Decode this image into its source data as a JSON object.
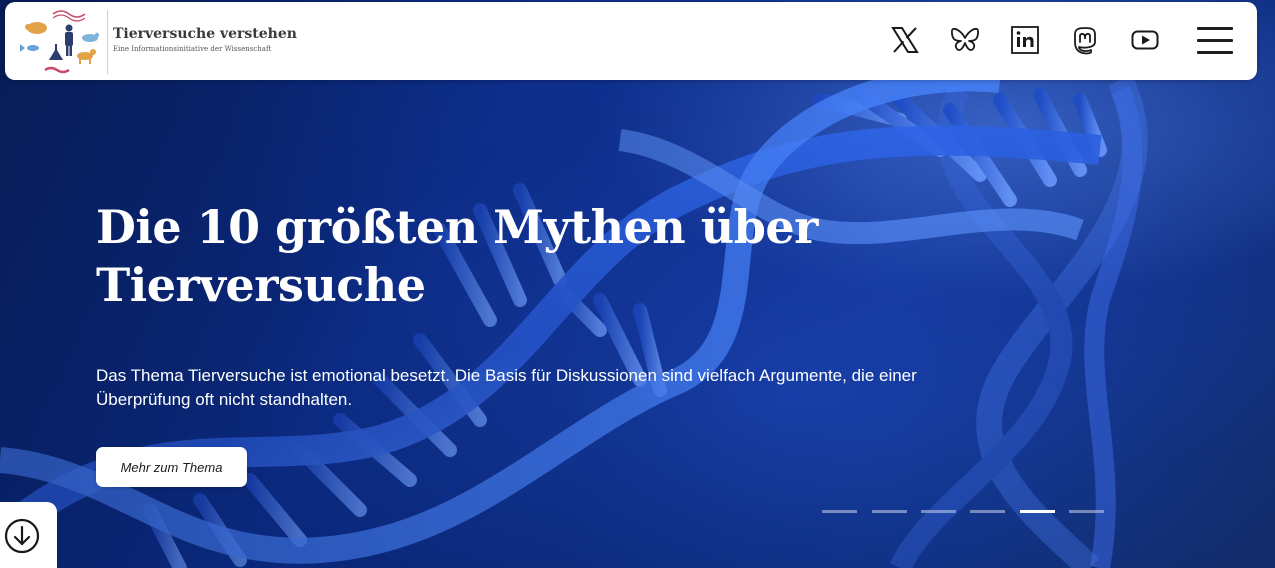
{
  "header": {
    "brand_title": "Tierversuche verstehen",
    "brand_subtitle": "Eine Informationsinitiative der Wissenschaft",
    "social_icons": [
      "x-icon",
      "bluesky-icon",
      "linkedin-icon",
      "mastodon-icon",
      "youtube-icon"
    ],
    "menu_icon": "hamburger-menu-icon"
  },
  "hero": {
    "headline": "Die 10 größten Mythen über Tierversuche",
    "lead": "Das Thema Tierversuche ist emotional besetzt. Die Basis für Diskussionen sind vielfach Argumente, die einer Überprüfung oft nicht standhalten.",
    "cta_label": "Mehr zum Thema",
    "slides_total": 6,
    "slide_active": 5,
    "scroll_icon": "arrow-down-circle-icon"
  },
  "colors": {
    "header_bg": "#ffffff",
    "hero_blue": "#0c2f8f",
    "text_white": "#ffffff"
  }
}
